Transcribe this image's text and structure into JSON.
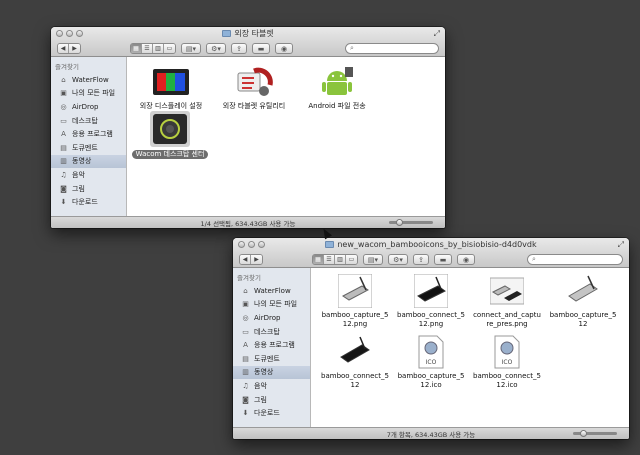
{
  "window1": {
    "title": "외장 타블렛",
    "sidebar": {
      "header": "즐겨찾기",
      "items": [
        {
          "label": "WaterFlow",
          "icon": "home-icon"
        },
        {
          "label": "나의 모든 파일",
          "icon": "all-files-icon"
        },
        {
          "label": "AirDrop",
          "icon": "airdrop-icon"
        },
        {
          "label": "데스크탑",
          "icon": "desktop-icon"
        },
        {
          "label": "응용 프로그램",
          "icon": "applications-icon"
        },
        {
          "label": "도큐멘트",
          "icon": "documents-icon"
        },
        {
          "label": "동영상",
          "icon": "movies-icon"
        },
        {
          "label": "음악",
          "icon": "music-icon"
        },
        {
          "label": "그림",
          "icon": "pictures-icon"
        },
        {
          "label": "다운로드",
          "icon": "downloads-icon"
        }
      ],
      "selected_index": 6
    },
    "files": [
      {
        "label": "외장 디스플레이 설정",
        "icon": "display-settings-icon"
      },
      {
        "label": "외장 타블렛 유틸리티",
        "icon": "tablet-utility-icon"
      },
      {
        "label": "Android 파일 전송",
        "icon": "android-icon"
      },
      {
        "label": "Wacom 데스크탑 센터",
        "icon": "wacom-center-icon"
      }
    ],
    "selected_file_index": 3,
    "status": "1/4 선택됨, 634.43GB 사용 가능"
  },
  "window2": {
    "title": "new_wacom_bambooicons_by_bisiobisio-d4d0vdk",
    "sidebar": {
      "header": "즐겨찾기",
      "items": [
        {
          "label": "WaterFlow",
          "icon": "home-icon"
        },
        {
          "label": "나의 모든 파일",
          "icon": "all-files-icon"
        },
        {
          "label": "AirDrop",
          "icon": "airdrop-icon"
        },
        {
          "label": "데스크탑",
          "icon": "desktop-icon"
        },
        {
          "label": "응용 프로그램",
          "icon": "applications-icon"
        },
        {
          "label": "도큐멘트",
          "icon": "documents-icon"
        },
        {
          "label": "동영상",
          "icon": "movies-icon"
        },
        {
          "label": "음악",
          "icon": "music-icon"
        },
        {
          "label": "그림",
          "icon": "pictures-icon"
        },
        {
          "label": "다운로드",
          "icon": "downloads-icon"
        }
      ],
      "selected_index": 6
    },
    "files": [
      {
        "label_line1": "bamboo_capture_5",
        "label_line2": "12.png",
        "icon": "silver-tablet-thumbnail-icon"
      },
      {
        "label_line1": "bamboo_connect_5",
        "label_line2": "12.png",
        "icon": "black-tablet-thumbnail-icon"
      },
      {
        "label_line1": "connect_and_captu",
        "label_line2": "re_pres.png",
        "icon": "two-tablets-thumbnail-icon"
      },
      {
        "label_line1": "bamboo_capture_5",
        "label_line2": "12",
        "icon": "silver-tablet-icon"
      },
      {
        "label_line1": "bamboo_connect_5",
        "label_line2": "12",
        "icon": "black-tablet-icon"
      },
      {
        "label_line1": "bamboo_capture_5",
        "label_line2": "12.ico",
        "icon": "ico-file-icon"
      },
      {
        "label_line1": "bamboo_connect_5",
        "label_line2": "12.ico",
        "icon": "ico-file-icon"
      }
    ],
    "ico_badge": "ICO",
    "status": "7개 항목, 634.43GB 사용 가능"
  },
  "toolbar": {
    "back_icon": "back-arrow-icon",
    "forward_icon": "forward-arrow-icon",
    "view_modes": [
      "icon-view-icon",
      "list-view-icon",
      "column-view-icon",
      "coverflow-view-icon"
    ],
    "arrange_icon": "arrange-icon",
    "action_icon": "gear-icon",
    "share_icon": "share-icon",
    "tag_icon": "tag-icon",
    "quicklook_icon": "eye-icon",
    "search_icon": "search-icon"
  },
  "colors": {
    "desktop_bg": "#3f3f3f",
    "sidebar_bg": "#e2e7ee",
    "selection_label_bg": "#6d6d6d"
  },
  "zoom_slider_fraction": 0.2
}
